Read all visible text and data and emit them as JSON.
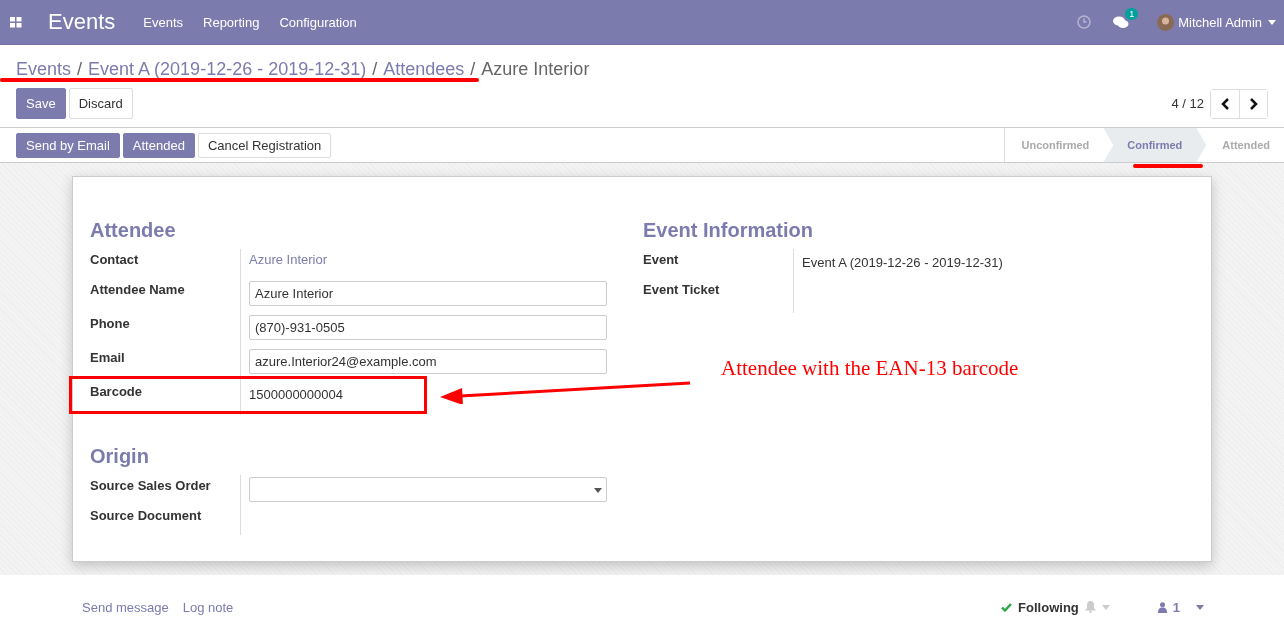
{
  "navbar": {
    "app_title": "Events",
    "menu": [
      "Events",
      "Reporting",
      "Configuration"
    ],
    "messages_badge": "1",
    "user": "Mitchell Admin"
  },
  "breadcrumb": [
    {
      "label": "Events",
      "separator": "/"
    },
    {
      "label": "Event A (2019-12-26 - 2019-12-31)",
      "separator": "/"
    },
    {
      "label": "Attendees",
      "separator": "/"
    }
  ],
  "breadcrumb_current": "Azure Interior",
  "buttons": [
    "Save",
    "Discard"
  ],
  "pager": "4 / 12",
  "actions": [
    {
      "label": "Send by Email",
      "primary": true
    },
    {
      "label": "Attended",
      "primary": true
    },
    {
      "label": "Cancel Registration",
      "primary": false
    }
  ],
  "stages": [
    {
      "label": "Unconfirmed",
      "selected": false
    },
    {
      "label": "Confirmed",
      "selected": true
    },
    {
      "label": "Attended",
      "selected": false
    }
  ],
  "attendee": {
    "title": "Attendee",
    "fields": [
      {
        "label": "Contact",
        "kind": "link",
        "value": "Azure Interior"
      },
      {
        "label": "Attendee Name",
        "kind": "input",
        "value": "Azure Interior"
      },
      {
        "label": "Phone",
        "kind": "input",
        "value": "(870)-931-0505"
      },
      {
        "label": "Email",
        "kind": "input",
        "value": "azure.Interior24@example.com"
      },
      {
        "label": "Barcode",
        "kind": "text",
        "value": "1500000000004"
      }
    ]
  },
  "event_information": {
    "title": "Event Information",
    "fields": [
      {
        "label": "Event",
        "kind": "text",
        "value": "Event A (2019-12-26 - 2019-12-31)"
      },
      {
        "label": "Event Ticket",
        "kind": "text"
      }
    ]
  },
  "origin": {
    "title": "Origin",
    "fields": [
      {
        "label": "Source Sales Order",
        "kind": "select"
      },
      {
        "label": "Source Document",
        "kind": "text"
      }
    ]
  },
  "chatter": {
    "links": [
      "Send message",
      "Log note"
    ],
    "following": "Following",
    "followers": "1"
  },
  "annotation": {
    "text": "Attendee with the EAN-13 barcode"
  }
}
